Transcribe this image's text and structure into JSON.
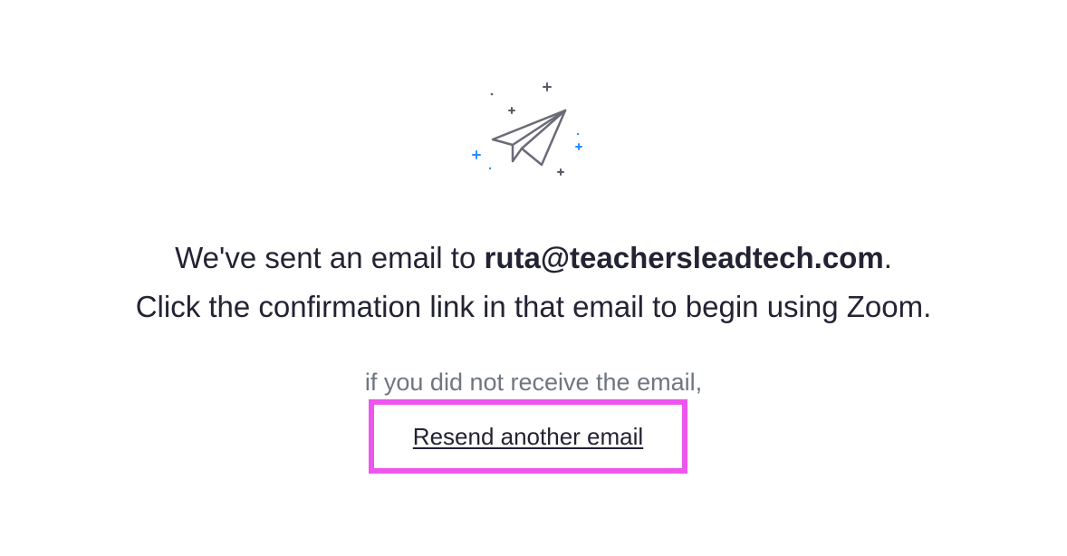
{
  "illustration": {
    "icon": "paper-plane-icon",
    "sparkle_colors": {
      "dark": "#5a5a66",
      "accent": "#2d8cff"
    }
  },
  "message": {
    "line1_prefix": "We've sent an email to ",
    "email": "ruta@teachersleadtech.com",
    "line1_suffix": ".",
    "line2": "Click the confirmation link in that email to begin using Zoom."
  },
  "hint": {
    "text": "if you did not receive the email,"
  },
  "resend": {
    "label": "Resend another email",
    "highlight_color": "#ee55ee"
  }
}
